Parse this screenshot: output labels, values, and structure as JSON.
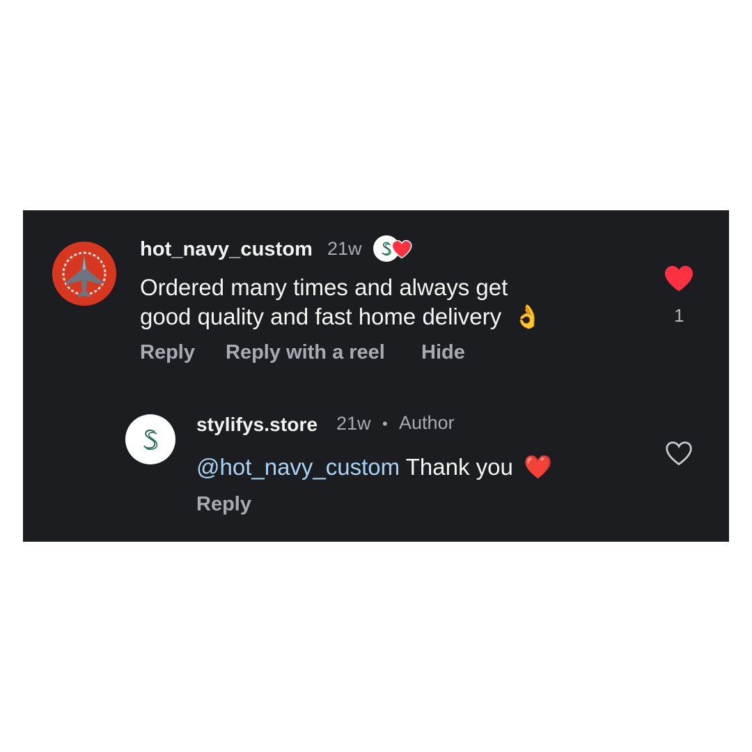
{
  "comment": {
    "username": "hot_navy_custom",
    "time": "21w",
    "text_line1": "Ordered many times and always get",
    "text_line2": "good quality and fast home delivery",
    "emoji": "👌",
    "like_count": "1",
    "actions": {
      "reply": "Reply",
      "reply_reel": "Reply with a reel",
      "hide": "Hide"
    }
  },
  "reply": {
    "username": "stylifys.store",
    "time": "21w",
    "separator": "•",
    "author_label": "Author",
    "mention": "@hot_navy_custom",
    "text": " Thank you",
    "emoji": "❤️",
    "action_reply": "Reply"
  },
  "colors": {
    "panel_bg": "#1b1d20",
    "like_red": "#ff3040",
    "mention_blue": "#a9d3f5",
    "avatar_red": "#d8371f",
    "brand_green": "#1f6b4f"
  },
  "icons": {
    "liked": "heart-filled-icon",
    "unliked": "heart-outline-icon",
    "creator_like": "creator-heart-badge-icon"
  }
}
